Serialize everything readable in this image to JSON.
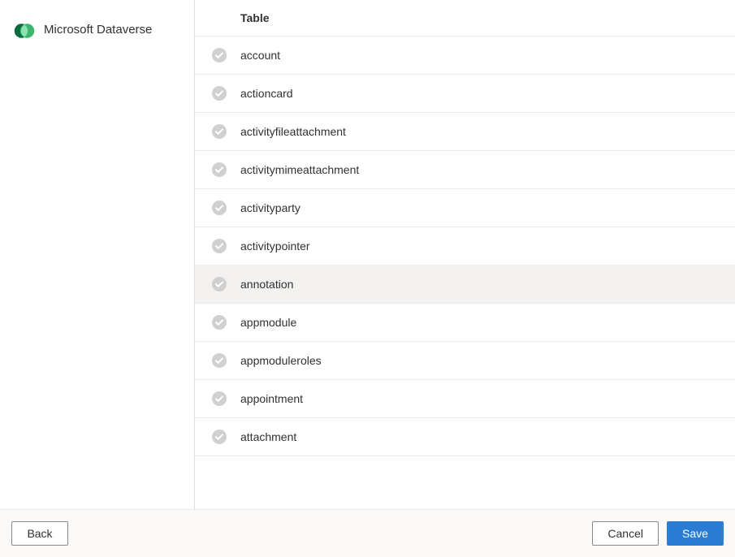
{
  "sidebar": {
    "title": "Microsoft Dataverse"
  },
  "table": {
    "header": "Table",
    "rows": [
      {
        "name": "account",
        "hovered": false
      },
      {
        "name": "actioncard",
        "hovered": false
      },
      {
        "name": "activityfileattachment",
        "hovered": false
      },
      {
        "name": "activitymimeattachment",
        "hovered": false
      },
      {
        "name": "activityparty",
        "hovered": false
      },
      {
        "name": "activitypointer",
        "hovered": false
      },
      {
        "name": "annotation",
        "hovered": true
      },
      {
        "name": "appmodule",
        "hovered": false
      },
      {
        "name": "appmoduleroles",
        "hovered": false
      },
      {
        "name": "appointment",
        "hovered": false
      },
      {
        "name": "attachment",
        "hovered": false
      }
    ]
  },
  "footer": {
    "back_label": "Back",
    "cancel_label": "Cancel",
    "save_label": "Save"
  }
}
